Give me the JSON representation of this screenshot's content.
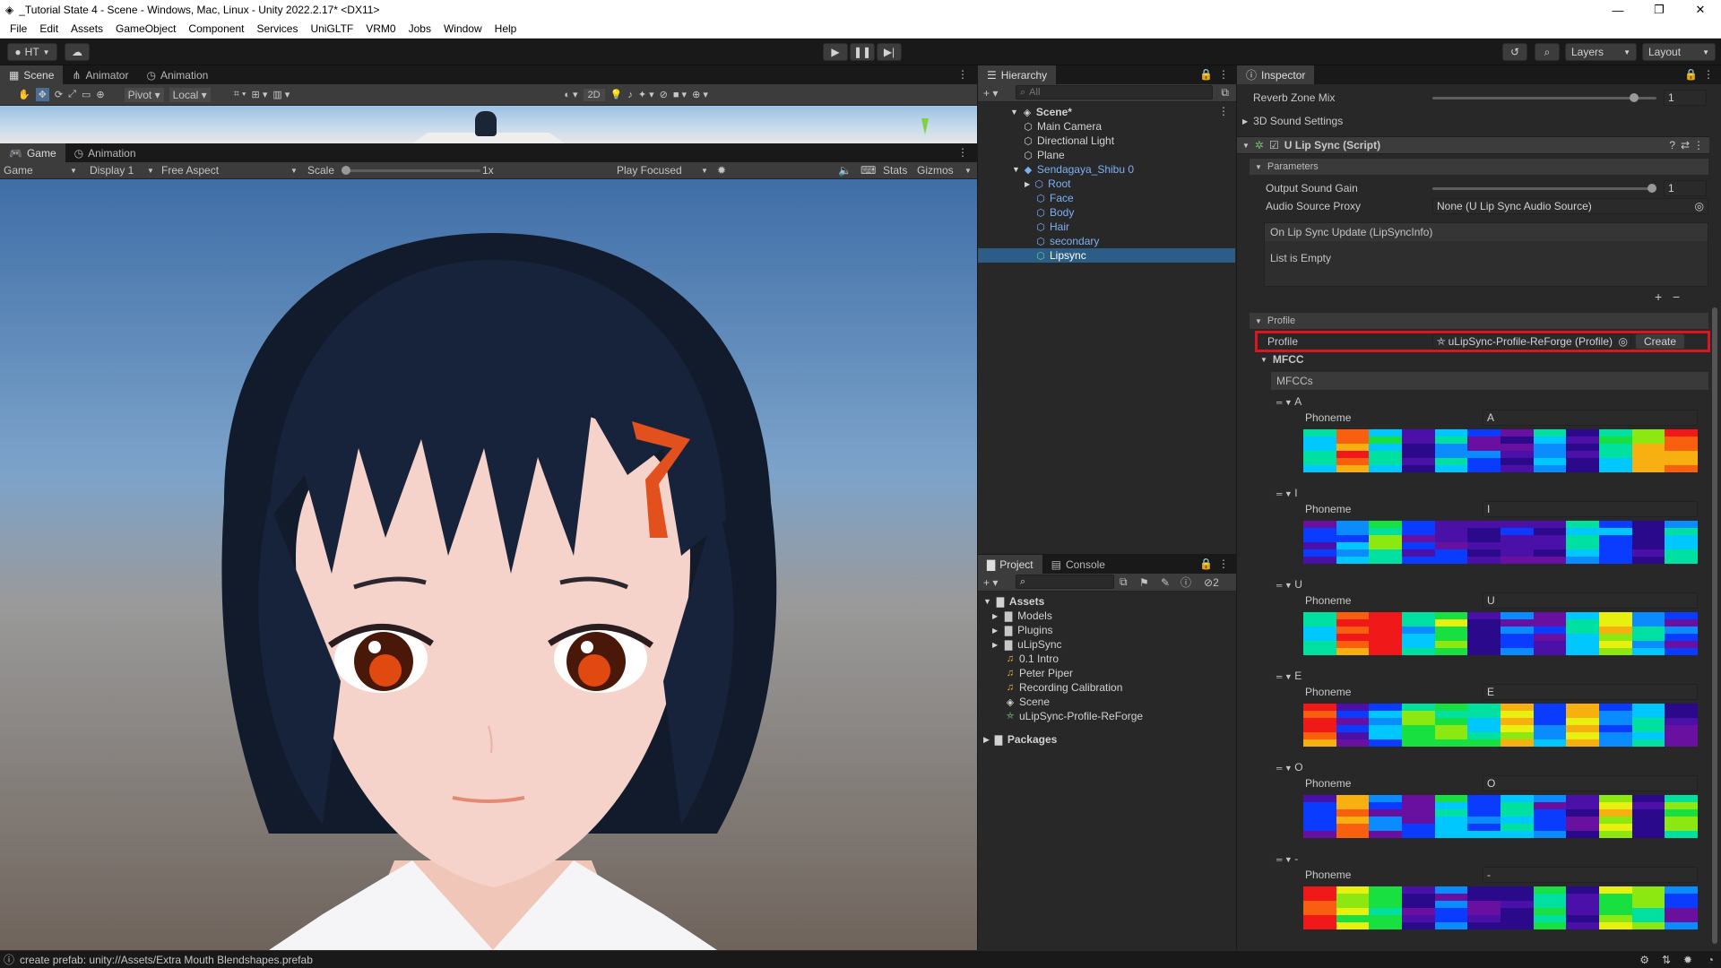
{
  "window": {
    "title": "_Tutorial State 4 - Scene - Windows, Mac, Linux - Unity 2022.2.17* <DX11>",
    "controls": [
      "—",
      "❐",
      "✕"
    ]
  },
  "menu": [
    "File",
    "Edit",
    "Assets",
    "GameObject",
    "Component",
    "Services",
    "UniGLTF",
    "VRM0",
    "Jobs",
    "Window",
    "Help"
  ],
  "toolbar": {
    "account": "HT",
    "layers": "Layers",
    "layout": "Layout"
  },
  "scene": {
    "tabs": [
      "Scene",
      "Animator",
      "Animation"
    ],
    "pivot": "Pivot",
    "local": "Local",
    "mode2d": "2D"
  },
  "game": {
    "tabs": [
      "Game",
      "Animation"
    ],
    "display_mode": "Game",
    "display": "Display 1",
    "aspect": "Free Aspect",
    "scale_label": "Scale",
    "scale_value": "1x",
    "play_focused": "Play Focused",
    "stats": "Stats",
    "gizmos": "Gizmos"
  },
  "hierarchy": {
    "tab": "Hierarchy",
    "search_placeholder": "All",
    "scene_name": "Scene*",
    "items": [
      {
        "label": "Main Camera",
        "blue": false,
        "indent": 1
      },
      {
        "label": "Directional Light",
        "blue": false,
        "indent": 1
      },
      {
        "label": "Plane",
        "blue": false,
        "indent": 1
      },
      {
        "label": "Sendagaya_Shibu 0",
        "blue": true,
        "indent": 1
      },
      {
        "label": "Root",
        "blue": true,
        "indent": 2
      },
      {
        "label": "Face",
        "blue": true,
        "indent": 2
      },
      {
        "label": "Body",
        "blue": true,
        "indent": 2
      },
      {
        "label": "Hair",
        "blue": true,
        "indent": 2
      },
      {
        "label": "secondary",
        "blue": true,
        "indent": 2
      },
      {
        "label": "Lipsync",
        "blue": false,
        "indent": 2,
        "selected": true
      }
    ]
  },
  "project": {
    "tabs": [
      "Project",
      "Console"
    ],
    "console_count": "2",
    "assets_label": "Assets",
    "items": [
      {
        "label": "Models",
        "type": "folder"
      },
      {
        "label": "Plugins",
        "type": "folder"
      },
      {
        "label": "uLipSync",
        "type": "folder"
      },
      {
        "label": "0.1 Intro",
        "type": "audio"
      },
      {
        "label": "Peter Piper",
        "type": "audio"
      },
      {
        "label": "Recording Calibration",
        "type": "audio"
      },
      {
        "label": "Scene",
        "type": "scene"
      },
      {
        "label": "uLipSync-Profile-ReForge",
        "type": "profile"
      }
    ],
    "packages_label": "Packages"
  },
  "inspector": {
    "tab": "Inspector",
    "reverb_label": "Reverb Zone Mix",
    "reverb_value": "1",
    "sound3d": "3D Sound Settings",
    "component": "U Lip Sync (Script)",
    "parameters": "Parameters",
    "gain_label": "Output Sound Gain",
    "gain_value": "1",
    "proxy_label": "Audio Source Proxy",
    "proxy_value": "None (U Lip Sync Audio Source)",
    "event_title": "On Lip Sync Update (LipSyncInfo)",
    "event_empty": "List is Empty",
    "profile_section": "Profile",
    "profile_label": "Profile",
    "profile_value": "uLipSync-Profile-ReForge (Profile)",
    "create": "Create",
    "mfcc": "MFCC",
    "mfccs": "MFCCs",
    "phoneme_label": "Phoneme",
    "highlight_color": "#e0141e",
    "phonemes": [
      {
        "name": "A",
        "value": "A"
      },
      {
        "name": "I",
        "value": "I"
      },
      {
        "name": "U",
        "value": "U"
      },
      {
        "name": "E",
        "value": "E"
      },
      {
        "name": "O",
        "value": "O"
      },
      {
        "name": "-",
        "value": "-"
      }
    ]
  },
  "status": {
    "message": "create prefab: unity://Assets/Extra Mouth Blendshapes.prefab"
  }
}
